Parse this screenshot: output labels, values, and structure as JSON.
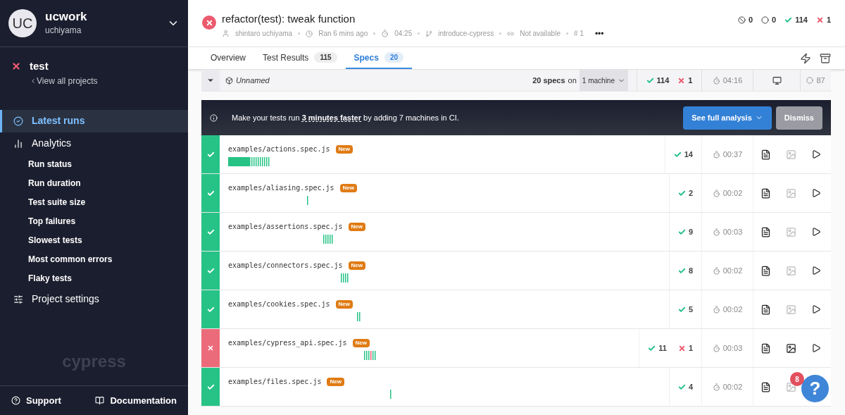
{
  "sidebar": {
    "avatar": "UC",
    "org": "ucwork",
    "user": "uchiyama",
    "project": {
      "name": "test",
      "failed": true,
      "back_link": "View all projects"
    },
    "nav": [
      {
        "label": "Latest runs",
        "selected": true
      },
      {
        "label": "Analytics",
        "selected": false,
        "children": [
          {
            "label": "Run status"
          },
          {
            "label": "Run duration"
          },
          {
            "label": "Test suite size"
          },
          {
            "label": "Top failures"
          },
          {
            "label": "Slowest tests"
          },
          {
            "label": "Most common errors"
          },
          {
            "label": "Flaky tests"
          }
        ]
      },
      {
        "label": "Project settings",
        "selected": false
      }
    ],
    "logo_text": "cypress",
    "footer": [
      {
        "label": "Support"
      },
      {
        "label": "Documentation"
      }
    ]
  },
  "run": {
    "title": "refactor(test): tweak function",
    "failed": true,
    "author": "shintaro uchiyama",
    "ran": "Ran 6 mins ago",
    "duration": "04:25",
    "branch": "introduce-cypress",
    "ci": "Not available",
    "number": "# 1",
    "more": "•••",
    "counts": {
      "skipped": "0",
      "pending": "0",
      "passed": "114",
      "failed": "1"
    }
  },
  "tabs": [
    {
      "label": "Overview",
      "selected": false
    },
    {
      "label": "Test Results",
      "count": "115",
      "selected": false
    },
    {
      "label": "Specs",
      "count": "20",
      "selected": true
    }
  ],
  "group": {
    "expanded": true,
    "name": "Unnamed",
    "specs": "20 specs",
    "on": "on",
    "machines": "1 machine",
    "passed": "114",
    "failed": "1",
    "duration": "04:16",
    "flake": "87"
  },
  "banner": {
    "before": "Make your tests run ",
    "highlight": "3 minutes faster",
    "after": " by adding 7 machines in CI.",
    "primary": "See full analysis",
    "secondary": "Dismiss"
  },
  "specs": [
    {
      "name": "examples/actions.spec.js",
      "badge": "New",
      "failing": false,
      "passed": "14",
      "duration": "00:37",
      "screenshots": false
    },
    {
      "name": "examples/aliasing.spec.js",
      "badge": "New",
      "failing": false,
      "passed": "2",
      "duration": "00:02",
      "screenshots": false
    },
    {
      "name": "examples/assertions.spec.js",
      "badge": "New",
      "failing": false,
      "passed": "9",
      "duration": "00:03",
      "screenshots": false
    },
    {
      "name": "examples/connectors.spec.js",
      "badge": "New",
      "failing": false,
      "passed": "8",
      "duration": "00:02",
      "screenshots": false
    },
    {
      "name": "examples/cookies.spec.js",
      "badge": "New",
      "failing": false,
      "passed": "5",
      "duration": "00:02",
      "screenshots": false
    },
    {
      "name": "examples/cypress_api.spec.js",
      "badge": "New",
      "failing": true,
      "passed": "11",
      "failed": "1",
      "duration": "00:03",
      "screenshots": true
    },
    {
      "name": "examples/files.spec.js",
      "badge": "New",
      "failing": false,
      "passed": "4",
      "duration": "00:02",
      "screenshots": false
    }
  ],
  "help": {
    "label": "?",
    "badge": "8"
  }
}
